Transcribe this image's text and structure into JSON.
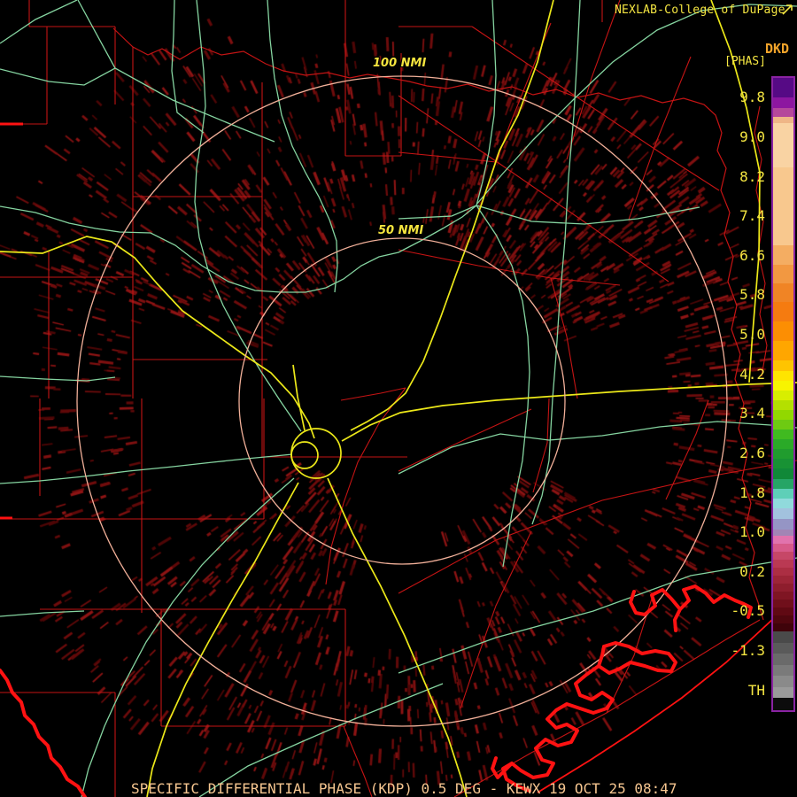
{
  "header": {
    "brand": "NEXLAB-College of DuPage",
    "product_id": "DKD",
    "units_label": "[PHAS]"
  },
  "rings": [
    {
      "label": "100 NMI"
    },
    {
      "label": "50 NMI"
    }
  ],
  "colorbar": {
    "ticks": [
      "9.8",
      "9.0",
      "8.2",
      "7.4",
      "6.6",
      "5.8",
      "5.0",
      "4.2",
      "3.4",
      "2.6",
      "1.8",
      "1.0",
      "0.2",
      "-0.5",
      "-1.3",
      "TH"
    ],
    "bands": [
      [
        "#560a85",
        22
      ],
      [
        "#8d16a0",
        12
      ],
      [
        "#b5489b",
        10
      ],
      [
        "#efb687",
        7
      ],
      [
        "#f9d3a3",
        50
      ],
      [
        "#f8c88e",
        88
      ],
      [
        "#f4ad62",
        21
      ],
      [
        "#f29841",
        21
      ],
      [
        "#f08425",
        21
      ],
      [
        "#f57b10",
        22
      ],
      [
        "#fc8e03",
        22
      ],
      [
        "#ffa600",
        22
      ],
      [
        "#ffc400",
        12
      ],
      [
        "#ffe400",
        11
      ],
      [
        "#f8f400",
        11
      ],
      [
        "#d8ee00",
        11
      ],
      [
        "#b4e000",
        11
      ],
      [
        "#92d800",
        11
      ],
      [
        "#6eca12",
        11
      ],
      [
        "#40ba20",
        11
      ],
      [
        "#2aaa28",
        11
      ],
      [
        "#209c2e",
        11
      ],
      [
        "#189234",
        11
      ],
      [
        "#108838",
        12
      ],
      [
        "#26a566",
        11
      ],
      [
        "#5ecfb8",
        11
      ],
      [
        "#90dadc",
        11
      ],
      [
        "#a2c2de",
        12
      ],
      [
        "#9595c5",
        12
      ],
      [
        "#a285b5",
        7
      ],
      [
        "#e173ad",
        9
      ],
      [
        "#d75a89",
        9
      ],
      [
        "#c64767",
        9
      ],
      [
        "#ba3953",
        9
      ],
      [
        "#ac2e43",
        9
      ],
      [
        "#9d2537",
        9
      ],
      [
        "#8e1d2d",
        9
      ],
      [
        "#7f1523",
        9
      ],
      [
        "#700f1b",
        9
      ],
      [
        "#600913",
        9
      ],
      [
        "#50060e",
        9
      ],
      [
        "#3f030a",
        9
      ],
      [
        "#4a4a4a",
        13
      ],
      [
        "#5a5a5a",
        12
      ],
      [
        "#6a6a6a",
        13
      ],
      [
        "#7a7a7a",
        12
      ],
      [
        "#8a8a8a",
        13
      ],
      [
        "#9a9a9a",
        12
      ],
      [
        "#0c0c0c",
        13
      ]
    ]
  },
  "footer": {
    "title": "SPECIFIC DIFFERENTIAL PHASE (KDP) 0.5 DEG - KEWX 19 OCT 25 08:47"
  },
  "colors": {
    "background": "#000000",
    "county_red": "#c51414",
    "coast_red": "#ff1212",
    "highway_green": "#85d4a0",
    "interstate_yellow": "#ece819",
    "range_ring": "#f2b099",
    "label_yellow": "#f5e642",
    "ring_label_yellow": "#f5e53e",
    "title_peach": "#f6c690",
    "dkd_orange": "#f0a32a",
    "colorbar_border": "#8a23a2",
    "noise_speckle": "#6e0c0c"
  }
}
